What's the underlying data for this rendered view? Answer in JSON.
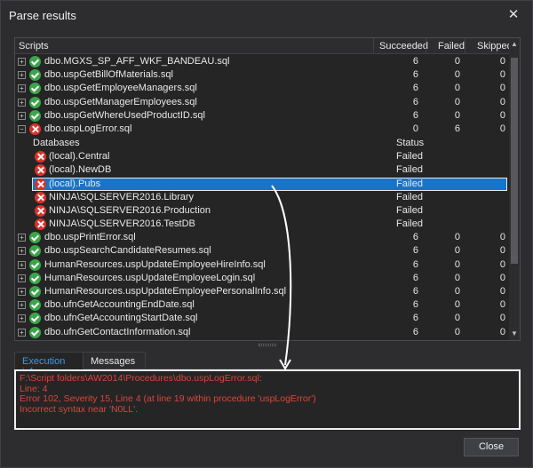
{
  "window": {
    "title": "Parse results",
    "close_glyph": "✕"
  },
  "grid": {
    "headers": {
      "scripts": "Scripts",
      "succeeded": "Succeeded",
      "failed": "Failed",
      "skipped": "Skipped"
    },
    "rows_top": [
      {
        "name": "dbo.MGXS_SP_AFF_WKF_BANDEAU.sql",
        "status": "ok",
        "succeeded": "6",
        "failed": "0",
        "skipped": "0"
      },
      {
        "name": "dbo.uspGetBillOfMaterials.sql",
        "status": "ok",
        "succeeded": "6",
        "failed": "0",
        "skipped": "0"
      },
      {
        "name": "dbo.uspGetEmployeeManagers.sql",
        "status": "ok",
        "succeeded": "6",
        "failed": "0",
        "skipped": "0"
      },
      {
        "name": "dbo.uspGetManagerEmployees.sql",
        "status": "ok",
        "succeeded": "6",
        "failed": "0",
        "skipped": "0"
      },
      {
        "name": "dbo.uspGetWhereUsedProductID.sql",
        "status": "ok",
        "succeeded": "6",
        "failed": "0",
        "skipped": "0"
      },
      {
        "name": "dbo.uspLogError.sql",
        "status": "err",
        "expanded": true,
        "succeeded": "0",
        "failed": "6",
        "skipped": "0"
      }
    ],
    "sub_headers": {
      "databases": "Databases",
      "status": "Status"
    },
    "sub_rows": [
      {
        "name": "(local).Central",
        "status": "Failed"
      },
      {
        "name": "(local).NewDB",
        "status": "Failed"
      },
      {
        "name": "(local).Pubs",
        "status": "Failed",
        "selected": true
      },
      {
        "name": "NINJA\\SQLSERVER2016.Library",
        "status": "Failed"
      },
      {
        "name": "NINJA\\SQLSERVER2016.Production",
        "status": "Failed"
      },
      {
        "name": "NINJA\\SQLSERVER2016.TestDB",
        "status": "Failed"
      }
    ],
    "rows_bottom": [
      {
        "name": "dbo.uspPrintError.sql",
        "status": "ok",
        "succeeded": "6",
        "failed": "0",
        "skipped": "0"
      },
      {
        "name": "dbo.uspSearchCandidateResumes.sql",
        "status": "ok",
        "succeeded": "6",
        "failed": "0",
        "skipped": "0"
      },
      {
        "name": "HumanResources.uspUpdateEmployeeHireInfo.sql",
        "status": "ok",
        "succeeded": "6",
        "failed": "0",
        "skipped": "0"
      },
      {
        "name": "HumanResources.uspUpdateEmployeeLogin.sql",
        "status": "ok",
        "succeeded": "6",
        "failed": "0",
        "skipped": "0"
      },
      {
        "name": "HumanResources.uspUpdateEmployeePersonalInfo.sql",
        "status": "ok",
        "succeeded": "6",
        "failed": "0",
        "skipped": "0"
      },
      {
        "name": "dbo.ufnGetAccountingEndDate.sql",
        "status": "ok",
        "succeeded": "6",
        "failed": "0",
        "skipped": "0"
      },
      {
        "name": "dbo.ufnGetAccountingStartDate.sql",
        "status": "ok",
        "succeeded": "6",
        "failed": "0",
        "skipped": "0"
      },
      {
        "name": "dbo.ufnGetContactInformation.sql",
        "status": "ok",
        "succeeded": "6",
        "failed": "0",
        "skipped": "0"
      }
    ]
  },
  "tabs": {
    "execution_info": "Execution info",
    "messages": "Messages"
  },
  "execution_info": {
    "lines": [
      "F:\\Script folders\\AW2014\\Procedures\\dbo.uspLogError.sql:",
      "Line: 4",
      "Error 102, Severity 15, Line 4 (at line 19 within procedure 'uspLogError')",
      "Incorrect syntax near 'N0LL'."
    ]
  },
  "buttons": {
    "close": "Close"
  },
  "colors": {
    "error": "#d9463b",
    "accent": "#3a9ae8",
    "selection": "#1874c9",
    "ok": "#3aa54a"
  }
}
